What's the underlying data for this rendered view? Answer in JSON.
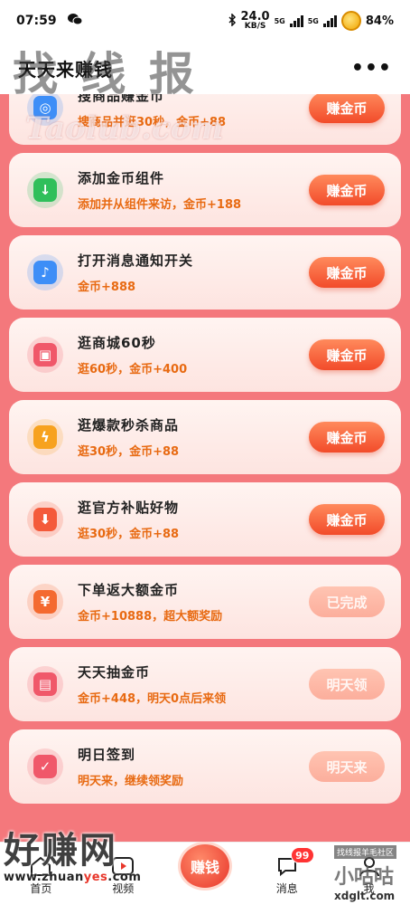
{
  "status_bar": {
    "time": "07:59",
    "net_speed_value": "24.0",
    "net_speed_unit": "KB/S",
    "signal_1": "5G",
    "signal_2": "5G",
    "battery": "84%"
  },
  "header": {
    "title": "天天来赚钱",
    "more_label": "•••"
  },
  "watermarks": {
    "top": "找 线 报",
    "top_sub": "Taolub.com",
    "bottom_left_big": "好赚网",
    "bottom_left_url_a": "www.zhuan",
    "bottom_left_url_b": "yes",
    "bottom_left_url_c": ".com",
    "bottom_right_tag": "找线报羊毛社区",
    "bottom_right_big": "小咕咕",
    "bottom_right_url": "xdglt.com"
  },
  "tasks": [
    {
      "title": "搜商品赚金币",
      "reward": "搜商品并逛30秒，金币+88",
      "button": "赚金币",
      "state": "active",
      "icon": "search-icon",
      "color": "#3d8ef7"
    },
    {
      "title": "添加金币组件",
      "reward": "添加并从组件来访，金币+188",
      "button": "赚金币",
      "state": "active",
      "icon": "download-widget-icon",
      "color": "#2fbf5a"
    },
    {
      "title": "打开消息通知开关",
      "reward": "金币+888",
      "button": "赚金币",
      "state": "active",
      "icon": "bell-icon",
      "color": "#3d8ef7"
    },
    {
      "title": "逛商城60秒",
      "reward": "逛60秒，金币+400",
      "button": "赚金币",
      "state": "active",
      "icon": "shopping-bag-icon",
      "color": "#f0586a"
    },
    {
      "title": "逛爆款秒杀商品",
      "reward": "逛30秒，金币+88",
      "button": "赚金币",
      "state": "active",
      "icon": "lightning-icon",
      "color": "#f7a21e"
    },
    {
      "title": "逛官方补贴好物",
      "reward": "逛30秒，金币+88",
      "button": "赚金币",
      "state": "active",
      "icon": "arrow-down-icon",
      "color": "#f45a3a"
    },
    {
      "title": "下单返大额金币",
      "reward": "金币+10888，超大额奖励",
      "button": "已完成",
      "state": "done",
      "icon": "coupon-yen-icon",
      "color": "#f46a30"
    },
    {
      "title": "天天抽金币",
      "reward": "金币+448，明天0点后来领",
      "button": "明天领",
      "state": "done",
      "icon": "lottery-machine-icon",
      "color": "#f0586a"
    },
    {
      "title": "明日签到",
      "reward": "明天来，继续领奖励",
      "button": "明天来",
      "state": "done",
      "icon": "calendar-check-icon",
      "color": "#f0586a"
    }
  ],
  "bottom_nav": {
    "home": "首页",
    "video": "视频",
    "center": "赚钱",
    "messages": "消息",
    "messages_badge": "99",
    "me": "我"
  }
}
